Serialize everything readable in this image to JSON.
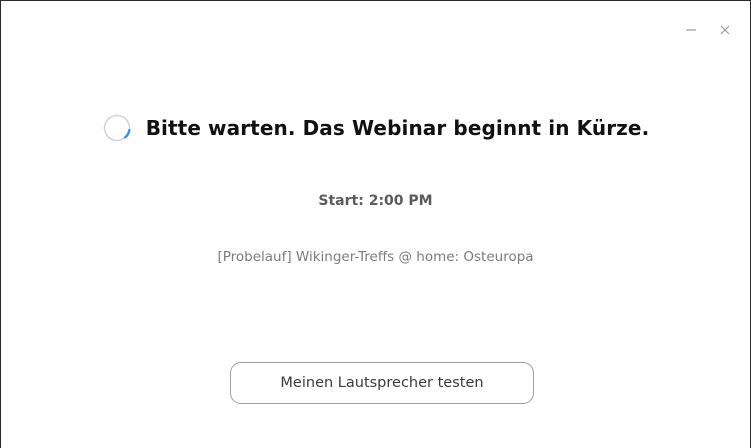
{
  "window": {
    "controls": {
      "minimize_icon": "minimize-icon",
      "close_icon": "close-icon"
    }
  },
  "main": {
    "status_icon": "loading-spinner-icon",
    "headline": "Bitte warten. Das Webinar beginnt in Kürze.",
    "start_time": "Start: 2:00 PM",
    "event_title": "[Probelauf] Wikinger-Treffs @ home: Osteuropa",
    "test_speaker_button": "Meinen Lautsprecher testen"
  },
  "colors": {
    "spinner_track": "#d4d4d4",
    "spinner_arc": "#2d8cff",
    "headline": "#111111",
    "secondary_text": "#5b5b5b",
    "muted_text": "#7c7c7c",
    "button_border": "#9e9e9e"
  }
}
